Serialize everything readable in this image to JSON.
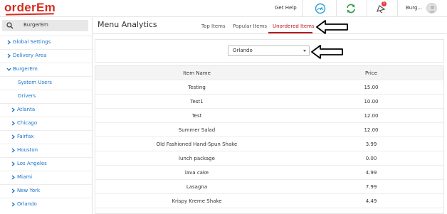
{
  "brand": {
    "logo_text": "orderEm",
    "color": "#d62b1f"
  },
  "topbar": {
    "help_label": "Get Help",
    "notification_count": "1",
    "user_name": "Burg..."
  },
  "sidebar": {
    "search_value": "BurgerEm",
    "items": [
      {
        "label": "Global Settings",
        "icon": "chevron-right-icon"
      },
      {
        "label": "Delivery Area",
        "icon": "chevron-right-icon"
      },
      {
        "label": "BurgerEm",
        "icon": "chevron-down-icon"
      },
      {
        "label": "System Users",
        "icon": ""
      },
      {
        "label": "Drivers",
        "icon": ""
      },
      {
        "label": "Atlanta",
        "icon": "chevron-right-icon"
      },
      {
        "label": "Chicago",
        "icon": "chevron-right-icon"
      },
      {
        "label": "Fairfax",
        "icon": "chevron-right-icon"
      },
      {
        "label": "Houston",
        "icon": "chevron-right-icon"
      },
      {
        "label": "Los Angeles",
        "icon": "chevron-right-icon"
      },
      {
        "label": "Miami",
        "icon": "chevron-right-icon"
      },
      {
        "label": "New York",
        "icon": "chevron-right-icon"
      },
      {
        "label": "Orlando",
        "icon": "chevron-right-icon"
      }
    ]
  },
  "main": {
    "title": "Menu Analytics",
    "tabs": [
      {
        "label": "Top Items",
        "active": false
      },
      {
        "label": "Popular Items",
        "active": false
      },
      {
        "label": "Unordered Items",
        "active": true
      }
    ],
    "city_select": {
      "value": "Orlando"
    },
    "table": {
      "columns": [
        "Item Name",
        "Price"
      ],
      "rows": [
        [
          "Testing",
          "15.00"
        ],
        [
          "Test1",
          "10.00"
        ],
        [
          "Test",
          "12.00"
        ],
        [
          "Summer Salad",
          "12.00"
        ],
        [
          "Old Fashioned Hand-Spun Shake",
          "3.99"
        ],
        [
          "lunch package",
          "0.00"
        ],
        [
          "lava cake",
          "4.99"
        ],
        [
          "Lasagna",
          "7.99"
        ],
        [
          "Krispy Kreme Shake",
          "4.49"
        ]
      ]
    }
  },
  "annotations": {
    "tab_callout": "11",
    "select_callout": "12",
    "color": "#e53935"
  }
}
